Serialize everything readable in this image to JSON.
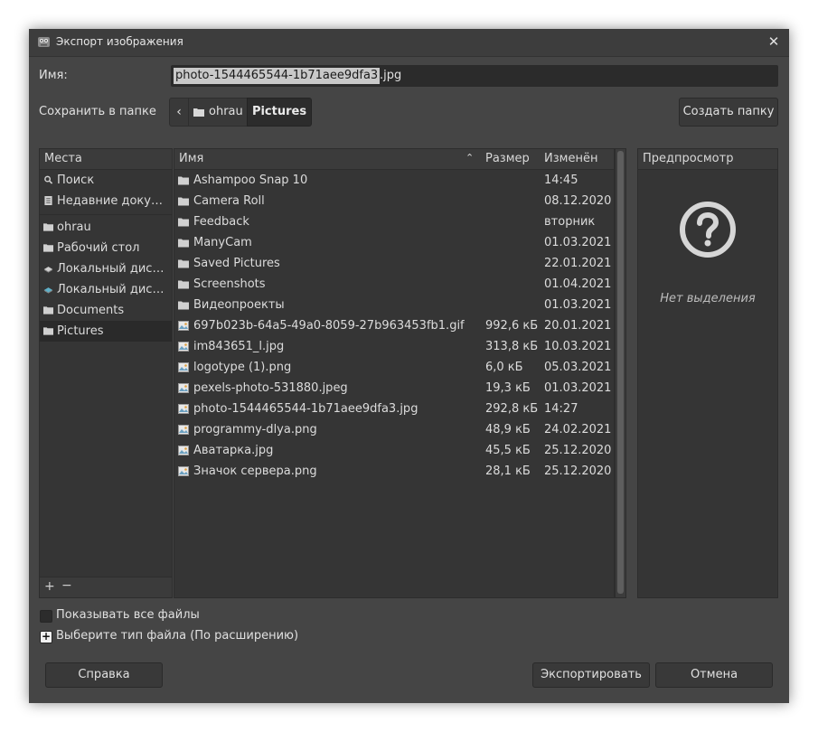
{
  "window": {
    "title": "Экспорт изображения",
    "close_glyph": "✕"
  },
  "name": {
    "label": "Имя:",
    "value_selected": "photo-1544465544-1b71aee9dfa3",
    "value_ext": ".jpg"
  },
  "save_in": {
    "label": "Сохранить в папке",
    "back_glyph": "‹",
    "crumbs": [
      "ohrau",
      "Pictures"
    ],
    "create_folder": "Создать папку"
  },
  "places": {
    "header": "Места",
    "items": [
      {
        "label": "Поиск",
        "icon": "search-icon"
      },
      {
        "label": "Недавние доку…",
        "icon": "recent-icon"
      },
      {
        "label": "ohrau",
        "icon": "folder-icon"
      },
      {
        "label": "Рабочий стол",
        "icon": "folder-icon"
      },
      {
        "label": "Локальный дис…",
        "icon": "drive-icon"
      },
      {
        "label": "Локальный дис…",
        "icon": "drive-icon"
      },
      {
        "label": "Documents",
        "icon": "folder-icon"
      },
      {
        "label": "Pictures",
        "icon": "folder-icon"
      }
    ],
    "add_glyph": "+",
    "remove_glyph": "−"
  },
  "files": {
    "columns": {
      "name": "Имя",
      "size": "Размер",
      "modified": "Изменён"
    },
    "sort_glyph": "⌃",
    "rows": [
      {
        "name": "Ashampoo Snap 10",
        "size": "",
        "modified": "14:45",
        "type": "folder"
      },
      {
        "name": "Camera Roll",
        "size": "",
        "modified": "08.12.2020",
        "type": "folder"
      },
      {
        "name": "Feedback",
        "size": "",
        "modified": "вторник",
        "type": "folder"
      },
      {
        "name": "ManyCam",
        "size": "",
        "modified": "01.03.2021",
        "type": "folder"
      },
      {
        "name": "Saved Pictures",
        "size": "",
        "modified": "22.01.2021",
        "type": "folder"
      },
      {
        "name": "Screenshots",
        "size": "",
        "modified": "01.04.2021",
        "type": "folder"
      },
      {
        "name": "Видеопроекты",
        "size": "",
        "modified": "01.03.2021",
        "type": "folder"
      },
      {
        "name": "697b023b-64a5-49a0-8059-27b963453fb1.gif",
        "size": "992,6 кБ",
        "modified": "20.01.2021",
        "type": "image"
      },
      {
        "name": "im843651_l.jpg",
        "size": "313,8 кБ",
        "modified": "10.03.2021",
        "type": "image"
      },
      {
        "name": "logotype (1).png",
        "size": "6,0 кБ",
        "modified": "05.03.2021",
        "type": "image"
      },
      {
        "name": "pexels-photo-531880.jpeg",
        "size": "19,3 кБ",
        "modified": "01.03.2021",
        "type": "image"
      },
      {
        "name": "photo-1544465544-1b71aee9dfa3.jpg",
        "size": "292,8 кБ",
        "modified": "14:27",
        "type": "image"
      },
      {
        "name": "programmy-dlya.png",
        "size": "48,9 кБ",
        "modified": "24.02.2021",
        "type": "image"
      },
      {
        "name": "Аватарка.jpg",
        "size": "45,5 кБ",
        "modified": "25.12.2020",
        "type": "image"
      },
      {
        "name": "Значок сервера.png",
        "size": "28,1 кБ",
        "modified": "25.12.2020",
        "type": "image"
      }
    ]
  },
  "preview": {
    "header": "Предпросмотр",
    "empty_text": "Нет выделения"
  },
  "options": {
    "show_all_files": "Показывать все файлы",
    "file_type": "Выберите тип файла (По расширению)",
    "expander_glyph": "+"
  },
  "buttons": {
    "help": "Справка",
    "export": "Экспортировать",
    "cancel": "Отмена"
  },
  "colors": {
    "window_bg": "#454545",
    "panel_bg": "#353535",
    "selected_row": "#2a2a2a",
    "text": "#dcdcdc"
  }
}
